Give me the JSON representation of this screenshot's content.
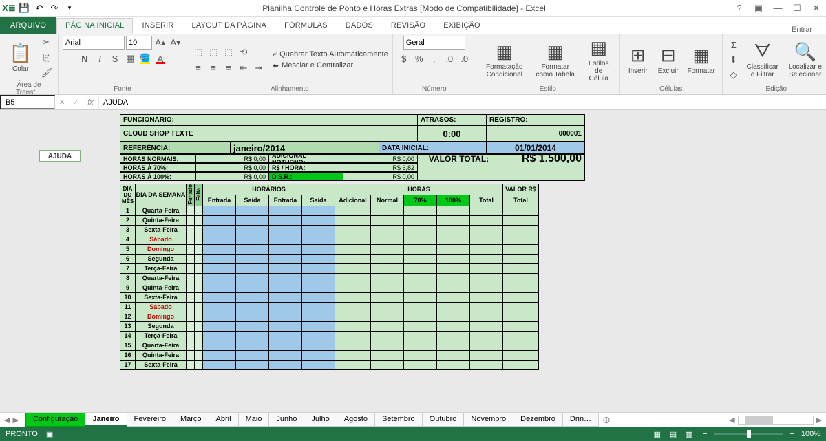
{
  "titlebar": {
    "title": "Planilha Controle de Ponto e Horas Extras  [Modo de Compatibilidade] - Excel"
  },
  "tabs": {
    "file": "ARQUIVO",
    "items": [
      "PÁGINA INICIAL",
      "INSERIR",
      "LAYOUT DA PÁGINA",
      "FÓRMULAS",
      "DADOS",
      "REVISÃO",
      "EXIBIÇÃO"
    ],
    "active": 0,
    "signin": "Entrar"
  },
  "ribbon": {
    "clipboard": {
      "paste": "Colar",
      "label": "Área de Transf…"
    },
    "font": {
      "name": "Arial",
      "size": "10",
      "label": "Fonte"
    },
    "align": {
      "wrap": "Quebrar Texto Automaticamente",
      "merge": "Mesclar e Centralizar",
      "label": "Alinhamento"
    },
    "number": {
      "format": "Geral",
      "label": "Número"
    },
    "styles": {
      "cond": "Formatação Condicional",
      "table": "Formatar como Tabela",
      "cell": "Estilos de Célula",
      "label": "Estilo"
    },
    "cells": {
      "insert": "Inserir",
      "delete": "Excluir",
      "format": "Formatar",
      "label": "Células"
    },
    "editing": {
      "sort": "Classificar e Filtrar",
      "find": "Localizar e Selecionar",
      "label": "Edição"
    }
  },
  "formula": {
    "cell": "B5",
    "value": "AJUDA"
  },
  "sheet": {
    "ajuda": "AJUDA",
    "funcionario_lbl": "FUNCIONÁRIO:",
    "funcionario": "CLOUD SHOP TEXTE",
    "atrasos_lbl": "ATRASOS:",
    "atrasos": "0:00",
    "registro_lbl": "REGISTRO:",
    "registro": "000001",
    "referencia_lbl": "REFERÊNCIA:",
    "referencia": "janeiro/2014",
    "data_inicial_lbl": "DATA INICIAL:",
    "data_inicial": "01/01/2014",
    "horas_normais_lbl": "HORAS NORMAIS:",
    "horas_normais": "R$ 0,00",
    "adicional_noturno_lbl": "ADICIONAL NOTURNO:",
    "adicional_noturno": "R$ 0,00",
    "horas_70_lbl": "HORAS À 70%:",
    "horas_70": "R$ 0,00",
    "rs_hora_lbl": "R$ / HORA:",
    "rs_hora": "R$ 6,82",
    "horas_100_lbl": "HORAS À 100%:",
    "horas_100": "R$ 0,00",
    "dsr_lbl": "D.S.R.:",
    "dsr": "R$ 0,00",
    "valor_total_lbl": "VALOR TOTAL:",
    "valor_total": "R$ 1.500,00",
    "headers": {
      "dia_mes": "DIA DO MÊS",
      "dia_semana": "DIA DA SEMANA",
      "feriado": "Feriado",
      "falta": "Falta",
      "horarios": "HORÁRIOS",
      "entrada": "Entrada",
      "saida": "Saída",
      "horas": "HORAS",
      "adicional": "Adicional",
      "normal": "Normal",
      "p70": "70%",
      "p100": "100%",
      "total": "Total",
      "valor_rs": "VALOR R$"
    },
    "rows": [
      {
        "n": 1,
        "d": "Quarta-Feira",
        "w": false
      },
      {
        "n": 2,
        "d": "Quinta-Feira",
        "w": false
      },
      {
        "n": 3,
        "d": "Sexta-Feira",
        "w": false
      },
      {
        "n": 4,
        "d": "Sábado",
        "w": true
      },
      {
        "n": 5,
        "d": "Domingo",
        "w": true
      },
      {
        "n": 6,
        "d": "Segunda",
        "w": false
      },
      {
        "n": 7,
        "d": "Terça-Feira",
        "w": false
      },
      {
        "n": 8,
        "d": "Quarta-Feira",
        "w": false
      },
      {
        "n": 9,
        "d": "Quinta-Feira",
        "w": false
      },
      {
        "n": 10,
        "d": "Sexta-Feira",
        "w": false
      },
      {
        "n": 11,
        "d": "Sábado",
        "w": true
      },
      {
        "n": 12,
        "d": "Domingo",
        "w": true
      },
      {
        "n": 13,
        "d": "Segunda",
        "w": false
      },
      {
        "n": 14,
        "d": "Terça-Feira",
        "w": false
      },
      {
        "n": 15,
        "d": "Quarta-Feira",
        "w": false
      },
      {
        "n": 16,
        "d": "Quinta-Feira",
        "w": false
      },
      {
        "n": 17,
        "d": "Sexta-Feira",
        "w": false
      }
    ]
  },
  "sheettabs": {
    "items": [
      "Configuração",
      "Janeiro",
      "Fevereiro",
      "Março",
      "Abril",
      "Maio",
      "Junho",
      "Julho",
      "Agosto",
      "Setembro",
      "Outubro",
      "Novembro",
      "Dezembro",
      "Drin…"
    ],
    "active": 1
  },
  "status": {
    "ready": "PRONTO",
    "zoom": "100%"
  }
}
